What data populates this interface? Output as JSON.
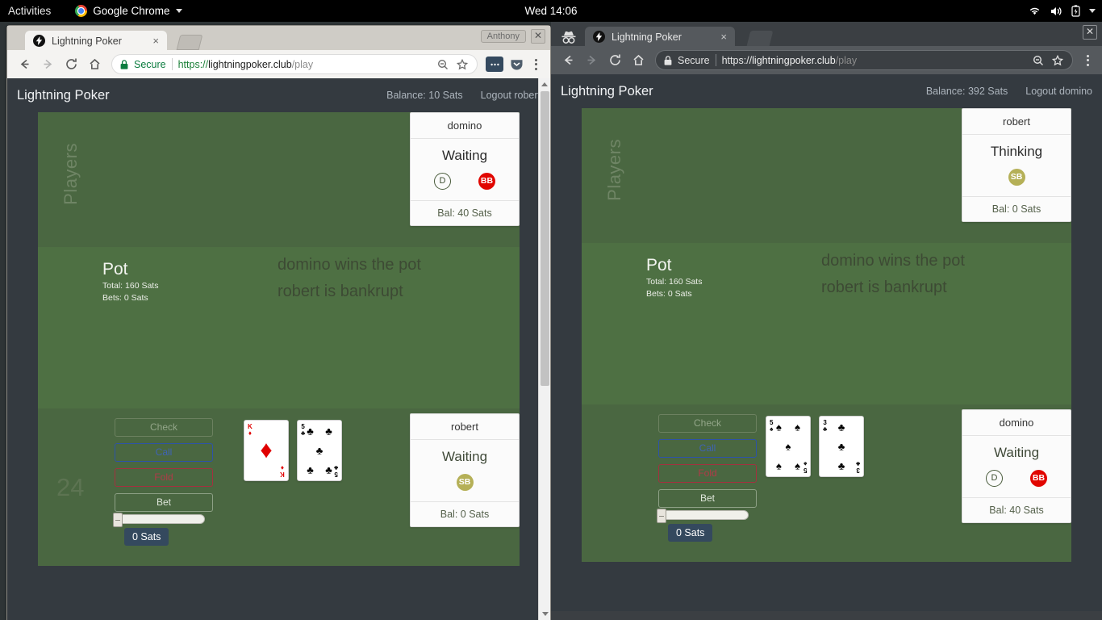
{
  "topbar": {
    "activities": "Activities",
    "app_menu": "Google Chrome",
    "clock": "Wed 14:06",
    "icons": [
      "wifi-icon",
      "volume-icon",
      "battery-icon",
      "caret-down-icon"
    ]
  },
  "windows": [
    {
      "id": "left",
      "profile_chip": "Anthony",
      "incognito": false,
      "tab": {
        "title": "Lightning Poker",
        "favicon": "lightning-bolt-icon",
        "close": "×"
      },
      "toolbar": {
        "back": "back-arrow-icon",
        "forward": "forward-arrow-icon",
        "reload": "reload-icon",
        "home": "home-icon",
        "security_label": "Secure",
        "url_scheme": "https://",
        "url_host": "lightningpoker.club",
        "url_path": "/play",
        "zoom_icon": "zoom-out-icon",
        "star_icon": "star-icon",
        "extension_icons": [
          "extension-icon",
          "pocket-icon"
        ],
        "menu": "kebab-menu-icon"
      },
      "app": {
        "brand": "Lightning Poker",
        "balance": "Balance: 10 Sats",
        "logout": "Logout robert",
        "players_label": "Players",
        "dim_number": "24",
        "top_player": {
          "name": "domino",
          "state": "Waiting",
          "balance": "Bal: 40 Sats",
          "badges": [
            {
              "type": "dealer",
              "text": "D"
            },
            {
              "type": "bb",
              "text": "BB"
            }
          ],
          "active": true
        },
        "bottom_player": {
          "name": "robert",
          "state": "Waiting",
          "balance": "Bal: 0 Sats",
          "badges": [
            {
              "type": "sb",
              "text": "SB"
            }
          ],
          "active": false
        },
        "pot": {
          "title": "Pot",
          "total": "Total: 160 Sats",
          "bets": "Bets: 0 Sats"
        },
        "messages": [
          "domino wins the pot",
          "robert is bankrupt"
        ],
        "buttons": {
          "check": "Check",
          "call": "Call",
          "fold": "Fold",
          "bet": "Bet"
        },
        "bet_amount": "0 Sats",
        "hand": [
          {
            "rank": "K",
            "suit": "♦",
            "color": "red",
            "count": 0
          },
          {
            "rank": "5",
            "suit": "♣",
            "color": "black",
            "count": 5
          }
        ]
      }
    },
    {
      "id": "right",
      "profile_chip": "",
      "incognito": true,
      "tab": {
        "title": "Lightning Poker",
        "favicon": "lightning-bolt-icon",
        "close": "×"
      },
      "toolbar": {
        "back": "back-arrow-icon",
        "forward": "forward-arrow-icon",
        "reload": "reload-icon",
        "home": "home-icon",
        "security_label": "Secure",
        "url_scheme": "https://",
        "url_host": "lightningpoker.club",
        "url_path": "/play",
        "zoom_icon": "zoom-out-icon",
        "star_icon": "star-icon",
        "extension_icons": [],
        "menu": "kebab-menu-icon"
      },
      "app": {
        "brand": "Lightning Poker",
        "balance": "Balance: 392 Sats",
        "logout": "Logout domino",
        "players_label": "Players",
        "dim_number": "",
        "top_player": {
          "name": "robert",
          "state": "Thinking",
          "balance": "Bal: 0 Sats",
          "badges": [
            {
              "type": "sb",
              "text": "SB"
            }
          ],
          "active": true
        },
        "bottom_player": {
          "name": "domino",
          "state": "Waiting",
          "balance": "Bal: 40 Sats",
          "badges": [
            {
              "type": "dealer",
              "text": "D"
            },
            {
              "type": "bb",
              "text": "BB"
            }
          ],
          "active": false
        },
        "pot": {
          "title": "Pot",
          "total": "Total: 160 Sats",
          "bets": "Bets: 0 Sats"
        },
        "messages": [
          "domino wins the pot",
          "robert is bankrupt"
        ],
        "buttons": {
          "check": "Check",
          "call": "Call",
          "fold": "Fold",
          "bet": "Bet"
        },
        "bet_amount": "0 Sats",
        "hand": [
          {
            "rank": "5",
            "suit": "♠",
            "color": "black",
            "count": 5
          },
          {
            "rank": "3",
            "suit": "♣",
            "color": "black",
            "count": 3
          }
        ]
      }
    }
  ],
  "colors": {
    "felt_dark": "#4a6741",
    "felt_light": "#4e7043",
    "app_bg": "#343a40",
    "bb_badge": "#e10600",
    "sb_badge": "#b5b057",
    "call_blue": "#3f63b4",
    "fold_red": "#b03a48",
    "chip_bg": "#34495e"
  }
}
